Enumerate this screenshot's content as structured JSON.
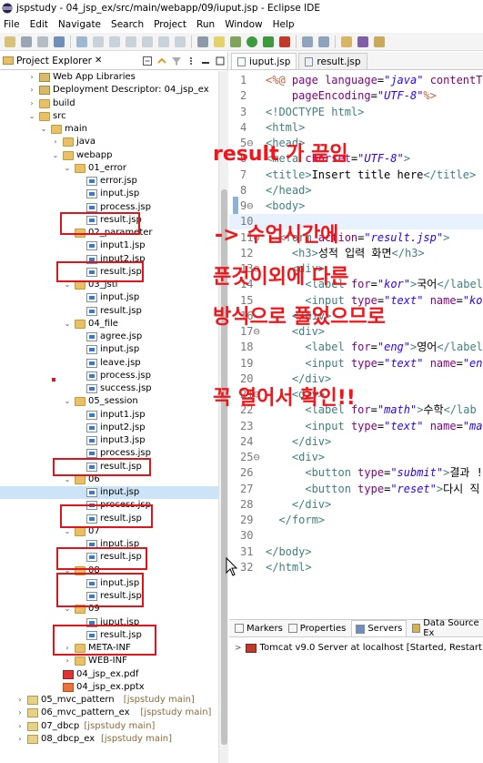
{
  "window": {
    "title": "jspstudy - 04_jsp_ex/src/main/webapp/09/iuput.jsp - Eclipse IDE"
  },
  "menu": [
    "File",
    "Edit",
    "Navigate",
    "Search",
    "Project",
    "Run",
    "Window",
    "Help"
  ],
  "explorer": {
    "tab_label": "Project Explorer",
    "close_glyph": "✕",
    "tree": [
      {
        "label": "Web App Libraries",
        "indent": 1,
        "arrow": ">",
        "icon": "lib"
      },
      {
        "label": "Deployment Descriptor: 04_jsp_ex",
        "indent": 1,
        "arrow": ">",
        "icon": "lib"
      },
      {
        "label": "build",
        "indent": 1,
        "arrow": ">",
        "icon": "folder"
      },
      {
        "label": "src",
        "indent": 1,
        "arrow": "v",
        "icon": "folder",
        "prefix": ">"
      },
      {
        "label": "main",
        "indent": 2,
        "arrow": "v",
        "icon": "folder"
      },
      {
        "label": "java",
        "indent": 3,
        "arrow": ">",
        "icon": "folder"
      },
      {
        "label": "webapp",
        "indent": 3,
        "arrow": "v",
        "icon": "folder"
      },
      {
        "label": "01_error",
        "indent": 4,
        "arrow": "v",
        "icon": "folder"
      },
      {
        "label": "error.jsp",
        "indent": 5,
        "arrow": "",
        "icon": "jsp"
      },
      {
        "label": "input.jsp",
        "indent": 5,
        "arrow": "",
        "icon": "jsp"
      },
      {
        "label": "process.jsp",
        "indent": 5,
        "arrow": "",
        "icon": "jsp"
      },
      {
        "label": "result.jsp",
        "indent": 5,
        "arrow": "",
        "icon": "jsp"
      },
      {
        "label": "02_parameter",
        "indent": 4,
        "arrow": "v",
        "icon": "folder"
      },
      {
        "label": "input1.jsp",
        "indent": 5,
        "arrow": "",
        "icon": "jsp"
      },
      {
        "label": "input2.jsp",
        "indent": 5,
        "arrow": "",
        "icon": "jsp"
      },
      {
        "label": "result.jsp",
        "indent": 5,
        "arrow": "",
        "icon": "jsp"
      },
      {
        "label": "03_jstl",
        "indent": 4,
        "arrow": "v",
        "icon": "folder"
      },
      {
        "label": "input.jsp",
        "indent": 5,
        "arrow": "",
        "icon": "jsp"
      },
      {
        "label": "result.jsp",
        "indent": 5,
        "arrow": "",
        "icon": "jsp"
      },
      {
        "label": "04_file",
        "indent": 4,
        "arrow": "v",
        "icon": "folder"
      },
      {
        "label": "agree.jsp",
        "indent": 5,
        "arrow": "",
        "icon": "jsp"
      },
      {
        "label": "input.jsp",
        "indent": 5,
        "arrow": "",
        "icon": "jsp"
      },
      {
        "label": "leave.jsp",
        "indent": 5,
        "arrow": "",
        "icon": "jsp"
      },
      {
        "label": "process.jsp",
        "indent": 5,
        "arrow": "",
        "icon": "jsp"
      },
      {
        "label": "success.jsp",
        "indent": 5,
        "arrow": "",
        "icon": "jsp"
      },
      {
        "label": "05_session",
        "indent": 4,
        "arrow": "v",
        "icon": "folder"
      },
      {
        "label": "input1.jsp",
        "indent": 5,
        "arrow": "",
        "icon": "jsp"
      },
      {
        "label": "input2.jsp",
        "indent": 5,
        "arrow": "",
        "icon": "jsp"
      },
      {
        "label": "input3.jsp",
        "indent": 5,
        "arrow": "",
        "icon": "jsp"
      },
      {
        "label": "process.jsp",
        "indent": 5,
        "arrow": "",
        "icon": "jsp"
      },
      {
        "label": "result.jsp",
        "indent": 5,
        "arrow": "",
        "icon": "jsp"
      },
      {
        "label": "06",
        "indent": 4,
        "arrow": "v",
        "icon": "folder"
      },
      {
        "label": "input.jsp",
        "indent": 5,
        "arrow": "",
        "icon": "jsp",
        "selected": true
      },
      {
        "label": "process.jsp",
        "indent": 5,
        "arrow": "",
        "icon": "jsp"
      },
      {
        "label": "result.jsp",
        "indent": 5,
        "arrow": "",
        "icon": "jsp"
      },
      {
        "label": "07",
        "indent": 4,
        "arrow": "v",
        "icon": "folder"
      },
      {
        "label": "input.jsp",
        "indent": 5,
        "arrow": "",
        "icon": "jsp"
      },
      {
        "label": "result.jsp",
        "indent": 5,
        "arrow": "",
        "icon": "jsp"
      },
      {
        "label": "08",
        "indent": 4,
        "arrow": "v",
        "icon": "folder"
      },
      {
        "label": "input.jsp",
        "indent": 5,
        "arrow": "",
        "icon": "jsp"
      },
      {
        "label": "result.jsp",
        "indent": 5,
        "arrow": "",
        "icon": "jsp"
      },
      {
        "label": "09",
        "indent": 4,
        "arrow": "v",
        "icon": "folder"
      },
      {
        "label": "iuput.jsp",
        "indent": 5,
        "arrow": "",
        "icon": "jsp"
      },
      {
        "label": "result.jsp",
        "indent": 5,
        "arrow": "",
        "icon": "jsp"
      },
      {
        "label": "META-INF",
        "indent": 4,
        "arrow": ">",
        "icon": "folder"
      },
      {
        "label": "WEB-INF",
        "indent": 4,
        "arrow": ">",
        "icon": "folder"
      },
      {
        "label": "04_jsp_ex.pdf",
        "indent": 3,
        "arrow": "",
        "icon": "pdf"
      },
      {
        "label": "04_jsp_ex.pptx",
        "indent": 3,
        "arrow": "",
        "icon": "ppt"
      },
      {
        "label": "05_mvc_pattern",
        "decor": "[jspstudy main]",
        "indent": 0,
        "arrow": ">",
        "icon": "proj"
      },
      {
        "label": "06_mvc_pattern_ex",
        "decor": "[jspstudy main]",
        "indent": 0,
        "arrow": ">",
        "icon": "proj"
      },
      {
        "label": "07_dbcp",
        "decor": "[jspstudy main]",
        "indent": 0,
        "arrow": ">",
        "icon": "proj"
      },
      {
        "label": "08_dbcp_ex",
        "decor": "[jspstudy main]",
        "indent": 0,
        "arrow": ">",
        "icon": "proj"
      }
    ]
  },
  "editor": {
    "tabs": [
      {
        "label": "iuput.jsp",
        "active": true
      },
      {
        "label": "result.jsp",
        "active": false
      }
    ],
    "lines": [
      {
        "n": "1",
        "html": "<span class='jsp'>&lt;%@</span> <span class='attr'>page</span> <span class='attr'>language</span>=<span class='str'>\"java\"</span> <span class='attr'>contentTy</span>"
      },
      {
        "n": "2",
        "html": "    <span class='attr'>pageEncoding</span>=<span class='str'>\"UTF-8\"</span><span class='jsp'>%&gt;</span>"
      },
      {
        "n": "3",
        "html": "<span class='tag'>&lt;!DOCTYPE html&gt;</span>"
      },
      {
        "n": "4",
        "html": "<span class='tag'>&lt;html&gt;</span>"
      },
      {
        "n": "5⊖",
        "html": "<span class='tag'>&lt;head&gt;</span>"
      },
      {
        "n": "6",
        "html": "<span class='tag'>&lt;meta</span> <span class='attr'>charset</span>=<span class='str'>\"UTF-8\"</span><span class='tag'>&gt;</span>"
      },
      {
        "n": "7",
        "html": "<span class='tag'>&lt;title&gt;</span>Insert title here<span class='tag'>&lt;/title&gt;</span>"
      },
      {
        "n": "8",
        "html": "<span class='tag'>&lt;/head&gt;</span>"
      },
      {
        "n": "9⊖",
        "html": "<span class='tag'>&lt;body&gt;</span>"
      },
      {
        "n": "10",
        "html": "",
        "current": true
      },
      {
        "n": "11⊖",
        "html": "  <span class='tag'>&lt;form</span> <span class='attr'>action</span>=<span class='str'>\"result.jsp\"</span><span class='tag'>&gt;</span>"
      },
      {
        "n": "12",
        "html": "    <span class='tag'>&lt;h3&gt;</span>성적 입력 화면<span class='tag'>&lt;/h3&gt;</span>"
      },
      {
        "n": "13⊖",
        "html": "    <span class='tag'>&lt;div&gt;</span>"
      },
      {
        "n": "14",
        "html": "      <span class='tag'>&lt;label</span> <span class='attr'>for</span>=<span class='str'>\"kor\"</span><span class='tag'>&gt;</span>국어<span class='tag'>&lt;/label</span>"
      },
      {
        "n": "15",
        "html": "      <span class='tag'>&lt;input</span> <span class='attr'>type</span>=<span class='str'>\"text\"</span> <span class='attr'>name</span>=<span class='str'>\"kor</span>"
      },
      {
        "n": "16",
        "html": "    <span class='tag'>&lt;/div&gt;</span>"
      },
      {
        "n": "17⊖",
        "html": "    <span class='tag'>&lt;div&gt;</span>"
      },
      {
        "n": "18",
        "html": "      <span class='tag'>&lt;label</span> <span class='attr'>for</span>=<span class='str'>\"eng\"</span><span class='tag'>&gt;</span>영어<span class='tag'>&lt;/label</span>"
      },
      {
        "n": "19",
        "html": "      <span class='tag'>&lt;input</span> <span class='attr'>type</span>=<span class='str'>\"text\"</span> <span class='attr'>name</span>=<span class='str'>\"eng</span>"
      },
      {
        "n": "20",
        "html": "    <span class='tag'>&lt;/div&gt;</span>"
      },
      {
        "n": "21⊖",
        "html": "    <span class='tag'>&lt;div&gt;</span>"
      },
      {
        "n": "22",
        "html": "      <span class='tag'>&lt;label</span> <span class='attr'>for</span>=<span class='str'>\"math\"</span><span class='tag'>&gt;</span>수학<span class='tag'>&lt;/lab</span>"
      },
      {
        "n": "23",
        "html": "      <span class='tag'>&lt;input</span> <span class='attr'>type</span>=<span class='str'>\"text\"</span> <span class='attr'>name</span>=<span class='str'>\"ma</span>"
      },
      {
        "n": "24",
        "html": "    <span class='tag'>&lt;/div&gt;</span>"
      },
      {
        "n": "25⊖",
        "html": "    <span class='tag'>&lt;div&gt;</span>"
      },
      {
        "n": "26",
        "html": "      <span class='tag'>&lt;button</span> <span class='attr'>type</span>=<span class='str'>\"submit\"</span><span class='tag'>&gt;</span>결과 !"
      },
      {
        "n": "27",
        "html": "      <span class='tag'>&lt;button</span> <span class='attr'>type</span>=<span class='str'>\"reset\"</span><span class='tag'>&gt;</span>다시 직"
      },
      {
        "n": "28",
        "html": "    <span class='tag'>&lt;/div&gt;</span>"
      },
      {
        "n": "29",
        "html": "  <span class='tag'>&lt;/form&gt;</span>"
      },
      {
        "n": "30",
        "html": ""
      },
      {
        "n": "31",
        "html": "<span class='tag'>&lt;/body&gt;</span>"
      },
      {
        "n": "32",
        "html": "<span class='tag'>&lt;/html&gt;</span>"
      }
    ]
  },
  "annotations": {
    "line1": "result 가 끝임",
    "line2": "-> 수업시간에",
    "line3": "푼것이외에 다른",
    "line4": "방식으로 풀었으므로",
    "line5": "꼭 열어서 확인!!"
  },
  "bottom_panel": {
    "tabs": [
      "Markers",
      "Properties",
      "Servers",
      "Data Source Ex"
    ],
    "server_row": "Tomcat v9.0 Server at localhost  [Started, Restart]"
  },
  "colors": {
    "annotation_red": "#f2151a",
    "box_red": "#e0141b",
    "selection": "#cde3f7"
  }
}
